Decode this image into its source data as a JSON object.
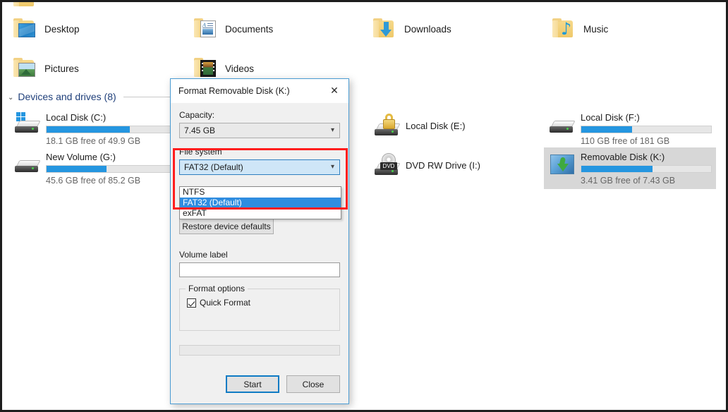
{
  "explorer": {
    "folders": [
      {
        "label": "Desktop",
        "icon": "folder-desktop-icon"
      },
      {
        "label": "Documents",
        "icon": "folder-documents-icon"
      },
      {
        "label": "Downloads",
        "icon": "folder-downloads-icon"
      },
      {
        "label": "Music",
        "icon": "folder-music-icon"
      },
      {
        "label": "Pictures",
        "icon": "folder-pictures-icon"
      },
      {
        "label": "Videos",
        "icon": "folder-videos-icon"
      }
    ],
    "group": {
      "label": "Devices and drives (8)",
      "chevron": "⌄"
    },
    "drives": [
      {
        "name": "Local Disk (C:)",
        "free_text": "18.1 GB free of 49.9 GB",
        "used_percent": 64,
        "icon": "windows-drive-icon",
        "selected": false
      },
      {
        "name": "New Volume (G:)",
        "free_text": "45.6 GB free of 85.2 GB",
        "used_percent": 46,
        "icon": "hard-drive-icon",
        "selected": false
      },
      {
        "name": "Local Disk (E:)",
        "free_text": "",
        "used_percent": null,
        "icon": "locked-drive-icon",
        "selected": false
      },
      {
        "name": "DVD RW Drive (I:)",
        "free_text": "",
        "used_percent": null,
        "icon": "dvd-drive-icon",
        "selected": false
      },
      {
        "name": "Local Disk (F:)",
        "free_text": "110 GB free of 181 GB",
        "used_percent": 39,
        "icon": "hard-drive-icon",
        "selected": false
      },
      {
        "name": "Removable Disk (K:)",
        "free_text": "3.41 GB free of 7.43 GB",
        "used_percent": 55,
        "icon": "removable-disk-icon",
        "selected": true
      }
    ]
  },
  "dialog": {
    "title": "Format Removable Disk (K:)",
    "close_icon": "close-icon",
    "capacity": {
      "label": "Capacity:",
      "value": "7.45 GB"
    },
    "file_system": {
      "label": "File system",
      "value": "FAT32 (Default)",
      "options": [
        "NTFS",
        "FAT32 (Default)",
        "exFAT"
      ],
      "selected_index": 1
    },
    "restore_button": "Restore device defaults",
    "volume_label": {
      "label": "Volume label",
      "value": ""
    },
    "format_options": {
      "title": "Format options",
      "quick_format": {
        "label": "Quick Format",
        "checked": true
      }
    },
    "buttons": {
      "start": "Start",
      "close": "Close"
    }
  },
  "colors": {
    "accent_blue": "#2596e0",
    "selection_blue": "#2f8de0",
    "highlight_red": "#ff1d1d",
    "focus_blue": "#0f7bc4"
  }
}
